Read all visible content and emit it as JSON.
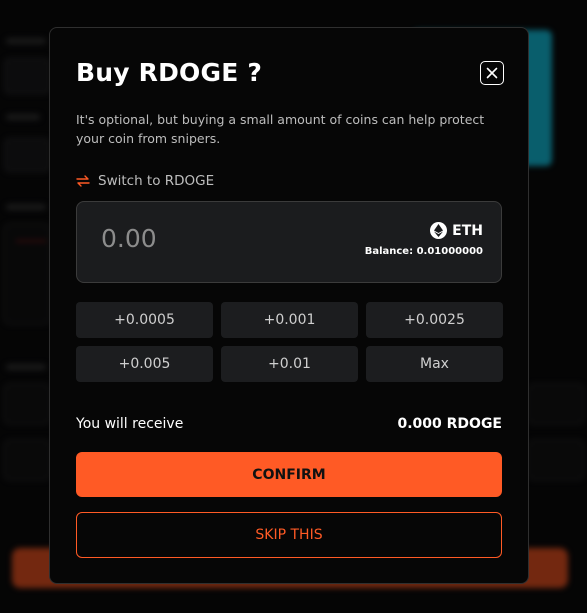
{
  "modal": {
    "title": "Buy RDOGE ?",
    "description": "It's optional, but buying a small amount of coins can help protect your coin from snipers.",
    "switch_label": "Switch to RDOGE",
    "amount_value": "0.00",
    "token_symbol": "ETH",
    "balance_text": "Balance: 0.01000000",
    "presets": [
      "+0.0005",
      "+0.001",
      "+0.0025",
      "+0.005",
      "+0.01",
      "Max"
    ],
    "receive_label": "You will receive",
    "receive_value": "0.000 RDOGE",
    "confirm_label": "CONFIRM",
    "skip_label": "SKIP THIS"
  },
  "icons": {
    "close": "close-icon",
    "switch": "swap-arrows-icon",
    "token": "ethereum-icon"
  },
  "colors": {
    "accent": "#ff5a25",
    "modal_bg": "#060606",
    "input_bg": "#1b1c1e",
    "preset_bg": "#1c1d1f"
  }
}
